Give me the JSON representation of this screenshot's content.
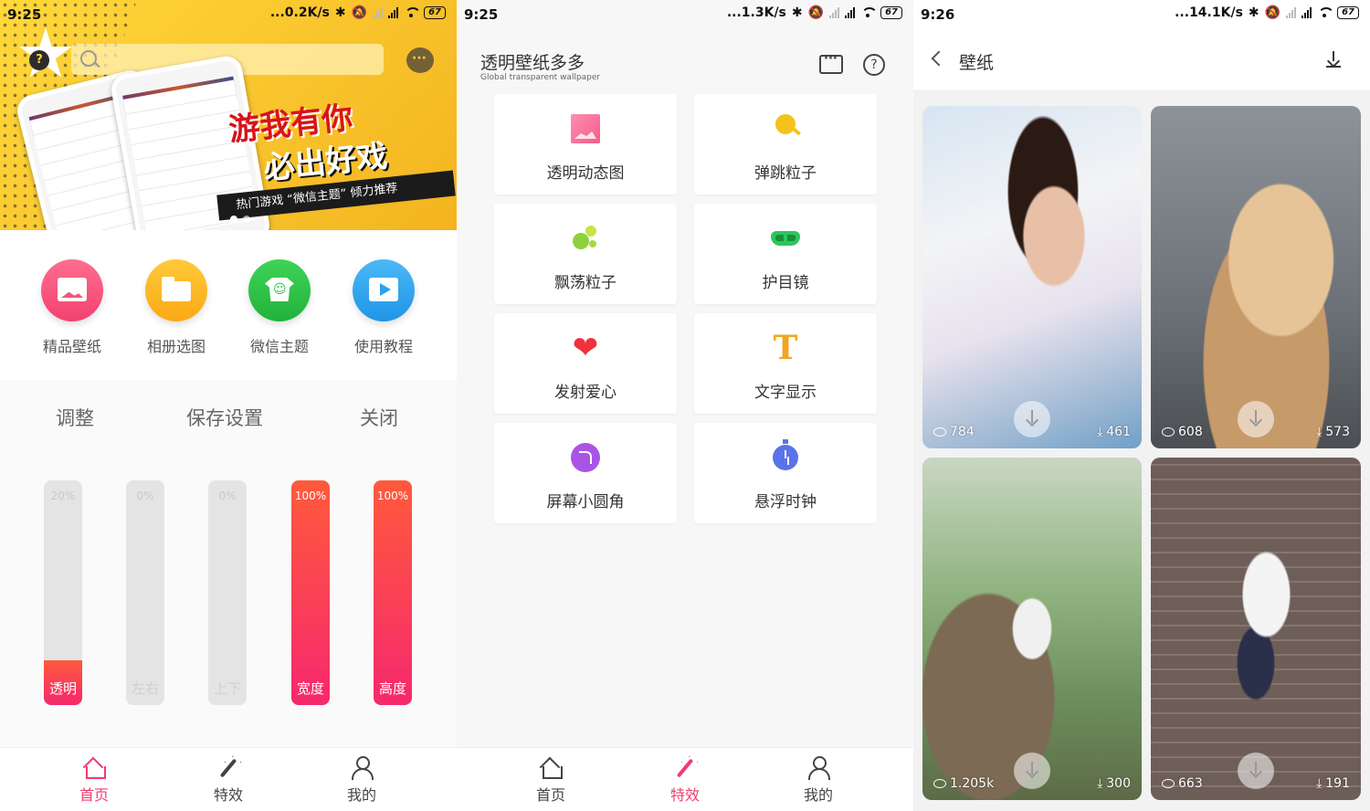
{
  "panel1": {
    "status": {
      "time": "9:25",
      "speed": "...0.2K/s",
      "battery": "67"
    },
    "quick_items": [
      {
        "label": "精品壁纸",
        "color": "#f54d7d"
      },
      {
        "label": "相册选图",
        "color": "#fbb320"
      },
      {
        "label": "微信主题",
        "color": "#2bc244"
      },
      {
        "label": "使用教程",
        "color": "#29a3ef"
      }
    ],
    "adjust_tabs": [
      "调整",
      "保存设置",
      "关闭"
    ],
    "bars": [
      {
        "name": "透明",
        "percent_label": "20%",
        "level": 0.2
      },
      {
        "name": "左右",
        "percent_label": "0%",
        "level": 0
      },
      {
        "name": "上下",
        "percent_label": "0%",
        "level": 0
      },
      {
        "name": "宽度",
        "percent_label": "100%",
        "level": 1
      },
      {
        "name": "高度",
        "percent_label": "100%",
        "level": 1
      }
    ],
    "nav": [
      {
        "label": "首页",
        "icon": "home-icon",
        "active": true
      },
      {
        "label": "特效",
        "icon": "magic-wand-icon",
        "active": false
      },
      {
        "label": "我的",
        "icon": "user-icon",
        "active": false
      }
    ]
  },
  "panel2": {
    "status": {
      "time": "9:25",
      "speed": "...1.3K/s",
      "battery": "67"
    },
    "title": "透明壁纸多多",
    "subtitle": "Global transparent wallpaper",
    "cards": [
      {
        "label": "透明动态图",
        "icon": "gif-icon"
      },
      {
        "label": "弹跳粒子",
        "icon": "bounce-particle-icon"
      },
      {
        "label": "飘荡粒子",
        "icon": "float-particle-icon"
      },
      {
        "label": "护目镜",
        "icon": "goggles-icon"
      },
      {
        "label": "发射爱心",
        "icon": "heart-icon"
      },
      {
        "label": "文字显示",
        "icon": "text-icon"
      },
      {
        "label": "屏幕小圆角",
        "icon": "round-corner-icon"
      },
      {
        "label": "悬浮时钟",
        "icon": "stopwatch-icon"
      }
    ],
    "nav": [
      {
        "label": "首页",
        "icon": "home-icon",
        "active": false
      },
      {
        "label": "特效",
        "icon": "magic-wand-icon",
        "active": true
      },
      {
        "label": "我的",
        "icon": "user-icon",
        "active": false
      }
    ]
  },
  "panel3": {
    "status": {
      "time": "9:26",
      "speed": "...14.1K/s",
      "battery": "67"
    },
    "title": "壁纸",
    "wallpapers": [
      {
        "views": "784",
        "downloads": "461"
      },
      {
        "views": "608",
        "downloads": "573"
      },
      {
        "views": "1.205k",
        "downloads": "300"
      },
      {
        "views": "663",
        "downloads": "191"
      }
    ]
  },
  "colors": {
    "accent": "#ee3d6f",
    "bar_gradient_top": "#ff5a3c",
    "bar_gradient_bottom": "#f5296e"
  }
}
